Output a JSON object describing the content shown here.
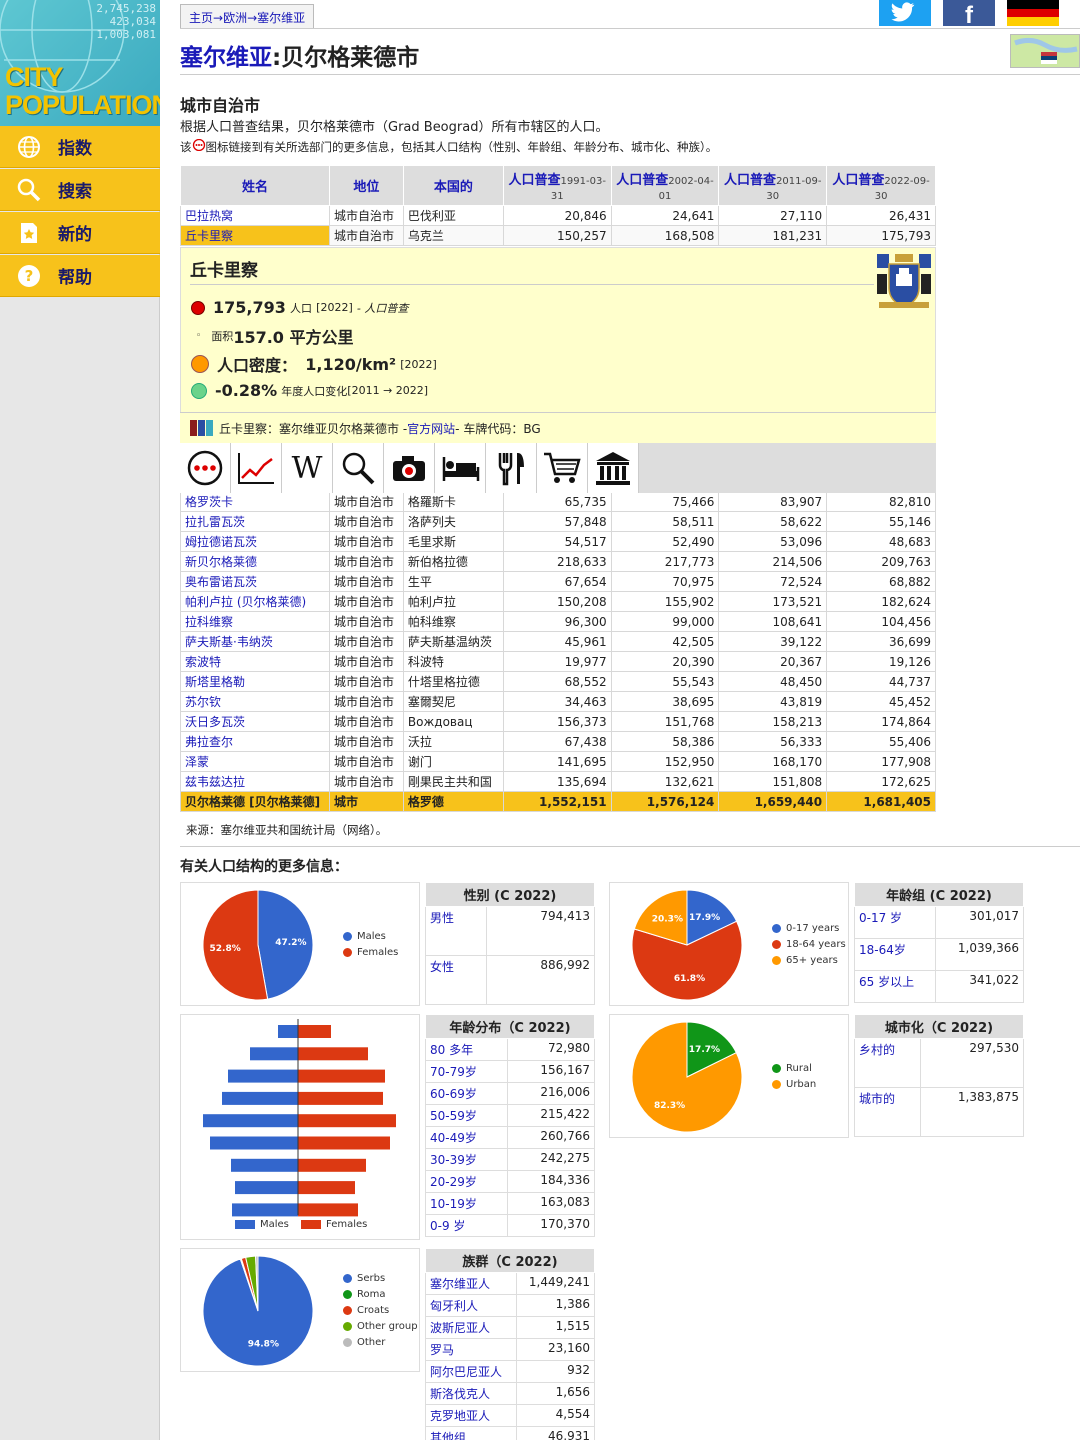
{
  "sidebar": {
    "logo": {
      "line1": "CITY",
      "line2": "POPULATION",
      "numbers": [
        "2,745,238",
        "423,034",
        "1,003,081"
      ]
    },
    "nav": [
      {
        "label": "指数",
        "icon": "globe-icon"
      },
      {
        "label": "搜索",
        "icon": "search-icon"
      },
      {
        "label": "新的",
        "icon": "new-star-icon"
      },
      {
        "label": "帮助",
        "icon": "help-icon"
      }
    ]
  },
  "breadcrumb": {
    "home": "主页",
    "sep": "→",
    "europe": "欧洲",
    "serbia": "塞尔维亚"
  },
  "title": {
    "country": "塞尔维亚",
    "sep": ":",
    "city": "贝尔格莱德市"
  },
  "section": {
    "heading": "城市自治市",
    "intro": "根据人口普查结果，贝尔格莱德市（Grad Beograd）所有市辖区的人口。",
    "note_pre": "该",
    "note_post": "图标链接到有关所选部门的更多信息，包括其人口结构（性别、年龄组、年龄分布、城市化、种族）。"
  },
  "table": {
    "headers": {
      "name": "姓名",
      "status": "地位",
      "native": "本国的",
      "census_label": "人口普查",
      "c1": "1991-03-31",
      "c2": "2002-04-01",
      "c3": "2011-09-30",
      "c4": "2022-09-30"
    },
    "top_rows": [
      {
        "name": "巴拉热窝",
        "status": "城市自治市",
        "native": "巴伐利亚",
        "v1": "20,846",
        "v2": "24,641",
        "v3": "27,110",
        "v4": "26,431"
      },
      {
        "name": "丘卡里察",
        "status": "城市自治市",
        "native": "乌克兰",
        "v1": "150,257",
        "v2": "168,508",
        "v3": "181,231",
        "v4": "175,793"
      }
    ],
    "rows": [
      {
        "name": "格罗茨卡",
        "status": "城市自治市",
        "native": "格羅斯卡",
        "v1": "65,735",
        "v2": "75,466",
        "v3": "83,907",
        "v4": "82,810"
      },
      {
        "name": "拉扎雷瓦茨",
        "status": "城市自治市",
        "native": "洛萨列夫",
        "v1": "57,848",
        "v2": "58,511",
        "v3": "58,622",
        "v4": "55,146"
      },
      {
        "name": "姆拉德诺瓦茨",
        "status": "城市自治市",
        "native": "毛里求斯",
        "v1": "54,517",
        "v2": "52,490",
        "v3": "53,096",
        "v4": "48,683"
      },
      {
        "name": "新贝尔格莱德",
        "status": "城市自治市",
        "native": "新伯格拉德",
        "v1": "218,633",
        "v2": "217,773",
        "v3": "214,506",
        "v4": "209,763"
      },
      {
        "name": "奥布雷诺瓦茨",
        "status": "城市自治市",
        "native": "生平",
        "v1": "67,654",
        "v2": "70,975",
        "v3": "72,524",
        "v4": "68,882"
      },
      {
        "name": "帕利卢拉 (贝尔格莱德)",
        "status": "城市自治市",
        "native": "帕利卢拉",
        "v1": "150,208",
        "v2": "155,902",
        "v3": "173,521",
        "v4": "182,624"
      },
      {
        "name": "拉科维察",
        "status": "城市自治市",
        "native": "帕科维察",
        "v1": "96,300",
        "v2": "99,000",
        "v3": "108,641",
        "v4": "104,456"
      },
      {
        "name": "萨夫斯基·韦纳茨",
        "status": "城市自治市",
        "native": "萨夫斯基温纳茨",
        "v1": "45,961",
        "v2": "42,505",
        "v3": "39,122",
        "v4": "36,699"
      },
      {
        "name": "索波特",
        "status": "城市自治市",
        "native": "科波特",
        "v1": "19,977",
        "v2": "20,390",
        "v3": "20,367",
        "v4": "19,126"
      },
      {
        "name": "斯塔里格勒",
        "status": "城市自治市",
        "native": "什塔里格拉德",
        "v1": "68,552",
        "v2": "55,543",
        "v3": "48,450",
        "v4": "44,737"
      },
      {
        "name": "苏尔钦",
        "status": "城市自治市",
        "native": "塞爾契尼",
        "v1": "34,463",
        "v2": "38,695",
        "v3": "43,819",
        "v4": "45,452"
      },
      {
        "name": "沃日多瓦茨",
        "status": "城市自治市",
        "native": "Вождовац",
        "v1": "156,373",
        "v2": "151,768",
        "v3": "158,213",
        "v4": "174,864"
      },
      {
        "name": "弗拉查尔",
        "status": "城市自治市",
        "native": "沃拉",
        "v1": "67,438",
        "v2": "58,386",
        "v3": "56,333",
        "v4": "55,406"
      },
      {
        "name": "泽蒙",
        "status": "城市自治市",
        "native": "谢门",
        "v1": "141,695",
        "v2": "152,950",
        "v3": "168,170",
        "v4": "177,908"
      },
      {
        "name": "兹韦兹达拉",
        "status": "城市自治市",
        "native": "剛果民主共和国",
        "v1": "135,694",
        "v2": "132,621",
        "v3": "151,808",
        "v4": "172,625"
      }
    ],
    "total": {
      "name": "贝尔格莱德 [贝尔格莱德]",
      "status": "城市",
      "native": "格罗德",
      "v1": "1,552,151",
      "v2": "1,576,124",
      "v3": "1,659,440",
      "v4": "1,681,405"
    }
  },
  "detail": {
    "title": "丘卡里察",
    "population": "175,793",
    "pop_label": "人口",
    "pop_year": "[2022]",
    "pop_src": "- 人口普查",
    "area_label": "面积",
    "area": "157.0 平方公里",
    "density_label": "人口密度：",
    "density": "1,120/km²",
    "density_year": "[2022]",
    "change": "-0.28%",
    "change_label": "年度人口变化",
    "change_period": "[2011 → 2022]",
    "footer_pre": "丘卡里察：塞尔维亚贝尔格莱德市 - ",
    "official": "官方网站",
    "footer_post": " - 车牌代码：BG",
    "icon_names": [
      "more-info-icon",
      "chart-icon",
      "wikipedia-icon",
      "search-icon",
      "camera-icon",
      "hotel-icon",
      "restaurant-icon",
      "shopping-cart-icon",
      "museum-icon"
    ],
    "wiki_letter": "W"
  },
  "source": "来源：塞尔维亚共和国统计局（网络）。",
  "more_title": "有关人口结构的更多信息：",
  "gender": {
    "title": "性别 (C 2022)",
    "rows": [
      {
        "label": "男性",
        "value": "794,413"
      },
      {
        "label": "女性",
        "value": "886,992"
      }
    ],
    "legend": [
      "Males",
      "Females"
    ],
    "pcts": [
      "47.2%",
      "52.8%"
    ],
    "colors": [
      "#3366cc",
      "#dc3912"
    ]
  },
  "agegroup": {
    "title": "年龄组 (C 2022)",
    "rows": [
      {
        "label": "0-17 岁",
        "value": "301,017"
      },
      {
        "label": "18-64岁",
        "value": "1,039,366"
      },
      {
        "label": "65 岁以上",
        "value": "341,022"
      }
    ],
    "legend": [
      "0-17 years",
      "18-64 years",
      "65+ years"
    ],
    "pcts": [
      "17.9%",
      "61.8%",
      "20.3%"
    ],
    "colors": [
      "#3366cc",
      "#dc3912",
      "#ff9900"
    ]
  },
  "agedist": {
    "title": "年龄分布（C 2022)",
    "rows": [
      {
        "label": "80 多年",
        "value": "72,980"
      },
      {
        "label": "70-79岁",
        "value": "156,167"
      },
      {
        "label": "60-69岁",
        "value": "216,006"
      },
      {
        "label": "50-59岁",
        "value": "215,422"
      },
      {
        "label": "40-49岁",
        "value": "260,766"
      },
      {
        "label": "30-39岁",
        "value": "242,275"
      },
      {
        "label": "20-29岁",
        "value": "184,336"
      },
      {
        "label": "10-19岁",
        "value": "163,083"
      },
      {
        "label": "0-9 岁",
        "value": "170,370"
      }
    ],
    "legend": [
      "Males",
      "Females"
    ],
    "males": [
      0.2,
      0.48,
      0.7,
      0.76,
      0.95,
      0.88,
      0.67,
      0.63,
      0.66
    ],
    "females": [
      0.33,
      0.7,
      0.87,
      0.85,
      0.98,
      0.92,
      0.68,
      0.57,
      0.6
    ]
  },
  "urban": {
    "title": "城市化（C 2022)",
    "rows": [
      {
        "label": "乡村的",
        "value": "297,530"
      },
      {
        "label": "城市的",
        "value": "1,383,875"
      }
    ],
    "legend": [
      "Rural",
      "Urban"
    ],
    "pcts": [
      "17.7%",
      "82.3%"
    ],
    "colors": [
      "#109618",
      "#ff9900"
    ]
  },
  "ethnic": {
    "title": "族群（C 2022)",
    "rows": [
      {
        "label": "塞尔维亚人",
        "value": "1,449,241"
      },
      {
        "label": "匈牙利人",
        "value": "1,386"
      },
      {
        "label": "波斯尼亚人",
        "value": "1,515"
      },
      {
        "label": "罗马",
        "value": "23,160"
      },
      {
        "label": "阿尔巴尼亚人",
        "value": "932"
      },
      {
        "label": "斯洛伐克人",
        "value": "1,656"
      },
      {
        "label": "克罗地亚人",
        "value": "4,554"
      },
      {
        "label": "其他组",
        "value": "46,931"
      }
    ],
    "legend": [
      "Serbs",
      "Roma",
      "Croats",
      "Other group",
      "Other"
    ],
    "pcts": [
      "94.8%"
    ],
    "colors": [
      "#3366cc",
      "#109618",
      "#dc3912",
      "#66aa00",
      "#bbbbbb"
    ]
  },
  "chart_data": [
    {
      "type": "pie",
      "title": "",
      "series": [
        {
          "values": [
            47.2,
            52.8
          ]
        }
      ],
      "categories": [
        "Males",
        "Females"
      ]
    },
    {
      "type": "pie",
      "title": "",
      "series": [
        {
          "values": [
            17.9,
            61.8,
            20.3
          ]
        }
      ],
      "categories": [
        "0-17 years",
        "18-64 years",
        "65+ years"
      ]
    },
    {
      "type": "bar",
      "title": "",
      "categories": [
        "80+",
        "70-79",
        "60-69",
        "50-59",
        "40-49",
        "30-39",
        "20-29",
        "10-19",
        "0-9"
      ],
      "series": [
        {
          "name": "Males",
          "values": [
            0.2,
            0.48,
            0.7,
            0.76,
            0.95,
            0.88,
            0.67,
            0.63,
            0.66
          ]
        },
        {
          "name": "Females",
          "values": [
            0.33,
            0.7,
            0.87,
            0.85,
            0.98,
            0.92,
            0.68,
            0.57,
            0.6
          ]
        }
      ]
    },
    {
      "type": "pie",
      "title": "",
      "series": [
        {
          "values": [
            17.7,
            82.3
          ]
        }
      ],
      "categories": [
        "Rural",
        "Urban"
      ]
    },
    {
      "type": "pie",
      "title": "",
      "series": [
        {
          "values": [
            94.8,
            0.3,
            1.3,
            2.9,
            0.7
          ]
        }
      ],
      "categories": [
        "Serbs",
        "Roma",
        "Croats",
        "Other group",
        "Other"
      ]
    }
  ]
}
